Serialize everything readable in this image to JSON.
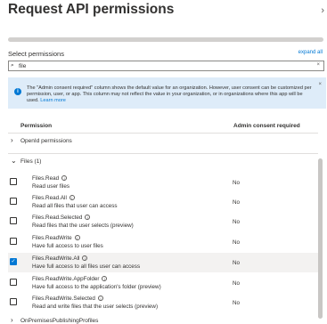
{
  "header": {
    "title": "Request API permissions",
    "close_glyph": "›"
  },
  "toolbar": {
    "select_label": "Select permissions",
    "expand_all": "expand all"
  },
  "search": {
    "value": "file",
    "clear_glyph": "×",
    "icon": "search-icon"
  },
  "info": {
    "text": "The \"Admin consent required\" column shows the default value for an organization. However, user consent can be customized per permission, user, or app. This column may not reflect the value in your organization, or in organizations where this app will be used.",
    "link": "Learn more",
    "close_glyph": "×"
  },
  "columns": {
    "permission": "Permission",
    "admin_consent": "Admin consent required"
  },
  "groups": [
    {
      "label": "OpenId permissions",
      "expanded": false
    },
    {
      "label": "Files (1)",
      "expanded": true
    },
    {
      "label": "OnPremisesPublishingProfiles",
      "expanded": false
    }
  ],
  "permissions": [
    {
      "name": "Files.Read",
      "description": "Read user files",
      "consent": "No",
      "checked": false
    },
    {
      "name": "Files.Read.All",
      "description": "Read all files that user can access",
      "consent": "No",
      "checked": false
    },
    {
      "name": "Files.Read.Selected",
      "description": "Read files that the user selects (preview)",
      "consent": "No",
      "checked": false
    },
    {
      "name": "Files.ReadWrite",
      "description": "Have full access to user files",
      "consent": "No",
      "checked": false
    },
    {
      "name": "Files.ReadWrite.All",
      "description": "Have full access to all files user can access",
      "consent": "No",
      "checked": true
    },
    {
      "name": "Files.ReadWrite.AppFolder",
      "description": "Have full access to the application's folder (preview)",
      "consent": "No",
      "checked": false
    },
    {
      "name": "Files.ReadWrite.Selected",
      "description": "Read and write files that the user selects (preview)",
      "consent": "No",
      "checked": false
    }
  ],
  "colors": {
    "accent": "#0078d4",
    "info_bg": "#deecf9",
    "selected_row": "#f3f2f1"
  }
}
